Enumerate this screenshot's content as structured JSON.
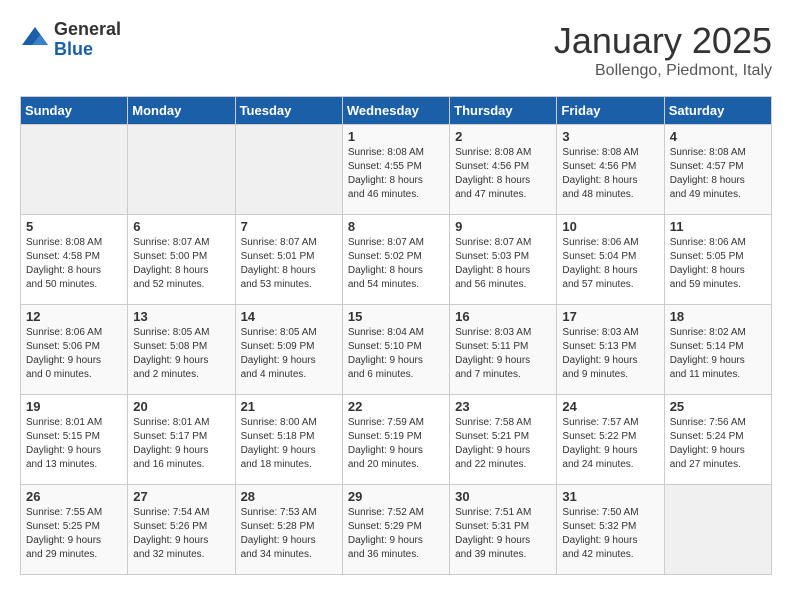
{
  "header": {
    "logo_general": "General",
    "logo_blue": "Blue",
    "title": "January 2025",
    "subtitle": "Bollengo, Piedmont, Italy"
  },
  "days_of_week": [
    "Sunday",
    "Monday",
    "Tuesday",
    "Wednesday",
    "Thursday",
    "Friday",
    "Saturday"
  ],
  "weeks": [
    [
      {
        "day": "",
        "info": ""
      },
      {
        "day": "",
        "info": ""
      },
      {
        "day": "",
        "info": ""
      },
      {
        "day": "1",
        "info": "Sunrise: 8:08 AM\nSunset: 4:55 PM\nDaylight: 8 hours\nand 46 minutes."
      },
      {
        "day": "2",
        "info": "Sunrise: 8:08 AM\nSunset: 4:56 PM\nDaylight: 8 hours\nand 47 minutes."
      },
      {
        "day": "3",
        "info": "Sunrise: 8:08 AM\nSunset: 4:56 PM\nDaylight: 8 hours\nand 48 minutes."
      },
      {
        "day": "4",
        "info": "Sunrise: 8:08 AM\nSunset: 4:57 PM\nDaylight: 8 hours\nand 49 minutes."
      }
    ],
    [
      {
        "day": "5",
        "info": "Sunrise: 8:08 AM\nSunset: 4:58 PM\nDaylight: 8 hours\nand 50 minutes."
      },
      {
        "day": "6",
        "info": "Sunrise: 8:07 AM\nSunset: 5:00 PM\nDaylight: 8 hours\nand 52 minutes."
      },
      {
        "day": "7",
        "info": "Sunrise: 8:07 AM\nSunset: 5:01 PM\nDaylight: 8 hours\nand 53 minutes."
      },
      {
        "day": "8",
        "info": "Sunrise: 8:07 AM\nSunset: 5:02 PM\nDaylight: 8 hours\nand 54 minutes."
      },
      {
        "day": "9",
        "info": "Sunrise: 8:07 AM\nSunset: 5:03 PM\nDaylight: 8 hours\nand 56 minutes."
      },
      {
        "day": "10",
        "info": "Sunrise: 8:06 AM\nSunset: 5:04 PM\nDaylight: 8 hours\nand 57 minutes."
      },
      {
        "day": "11",
        "info": "Sunrise: 8:06 AM\nSunset: 5:05 PM\nDaylight: 8 hours\nand 59 minutes."
      }
    ],
    [
      {
        "day": "12",
        "info": "Sunrise: 8:06 AM\nSunset: 5:06 PM\nDaylight: 9 hours\nand 0 minutes."
      },
      {
        "day": "13",
        "info": "Sunrise: 8:05 AM\nSunset: 5:08 PM\nDaylight: 9 hours\nand 2 minutes."
      },
      {
        "day": "14",
        "info": "Sunrise: 8:05 AM\nSunset: 5:09 PM\nDaylight: 9 hours\nand 4 minutes."
      },
      {
        "day": "15",
        "info": "Sunrise: 8:04 AM\nSunset: 5:10 PM\nDaylight: 9 hours\nand 6 minutes."
      },
      {
        "day": "16",
        "info": "Sunrise: 8:03 AM\nSunset: 5:11 PM\nDaylight: 9 hours\nand 7 minutes."
      },
      {
        "day": "17",
        "info": "Sunrise: 8:03 AM\nSunset: 5:13 PM\nDaylight: 9 hours\nand 9 minutes."
      },
      {
        "day": "18",
        "info": "Sunrise: 8:02 AM\nSunset: 5:14 PM\nDaylight: 9 hours\nand 11 minutes."
      }
    ],
    [
      {
        "day": "19",
        "info": "Sunrise: 8:01 AM\nSunset: 5:15 PM\nDaylight: 9 hours\nand 13 minutes."
      },
      {
        "day": "20",
        "info": "Sunrise: 8:01 AM\nSunset: 5:17 PM\nDaylight: 9 hours\nand 16 minutes."
      },
      {
        "day": "21",
        "info": "Sunrise: 8:00 AM\nSunset: 5:18 PM\nDaylight: 9 hours\nand 18 minutes."
      },
      {
        "day": "22",
        "info": "Sunrise: 7:59 AM\nSunset: 5:19 PM\nDaylight: 9 hours\nand 20 minutes."
      },
      {
        "day": "23",
        "info": "Sunrise: 7:58 AM\nSunset: 5:21 PM\nDaylight: 9 hours\nand 22 minutes."
      },
      {
        "day": "24",
        "info": "Sunrise: 7:57 AM\nSunset: 5:22 PM\nDaylight: 9 hours\nand 24 minutes."
      },
      {
        "day": "25",
        "info": "Sunrise: 7:56 AM\nSunset: 5:24 PM\nDaylight: 9 hours\nand 27 minutes."
      }
    ],
    [
      {
        "day": "26",
        "info": "Sunrise: 7:55 AM\nSunset: 5:25 PM\nDaylight: 9 hours\nand 29 minutes."
      },
      {
        "day": "27",
        "info": "Sunrise: 7:54 AM\nSunset: 5:26 PM\nDaylight: 9 hours\nand 32 minutes."
      },
      {
        "day": "28",
        "info": "Sunrise: 7:53 AM\nSunset: 5:28 PM\nDaylight: 9 hours\nand 34 minutes."
      },
      {
        "day": "29",
        "info": "Sunrise: 7:52 AM\nSunset: 5:29 PM\nDaylight: 9 hours\nand 36 minutes."
      },
      {
        "day": "30",
        "info": "Sunrise: 7:51 AM\nSunset: 5:31 PM\nDaylight: 9 hours\nand 39 minutes."
      },
      {
        "day": "31",
        "info": "Sunrise: 7:50 AM\nSunset: 5:32 PM\nDaylight: 9 hours\nand 42 minutes."
      },
      {
        "day": "",
        "info": ""
      }
    ]
  ]
}
